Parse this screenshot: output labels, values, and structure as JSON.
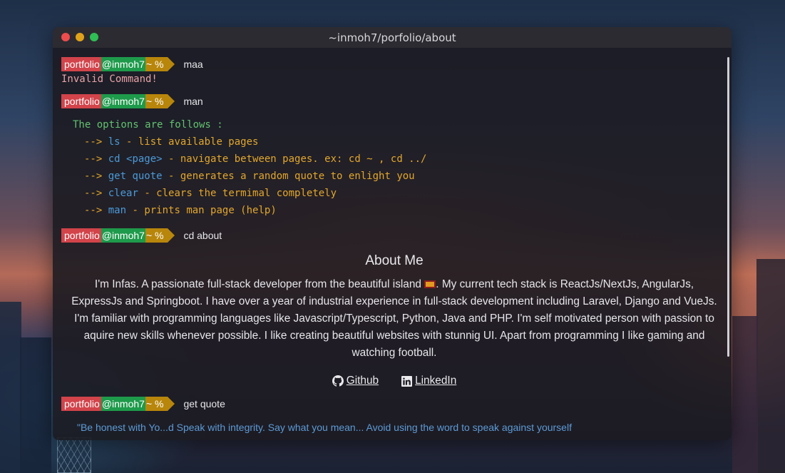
{
  "window": {
    "title": "~inmoh7/porfolio/about"
  },
  "prompt": {
    "user": "portfolio",
    "host": "@inmoh7",
    "dir": "~ %"
  },
  "history": {
    "cmd1": "maa",
    "error1": "Invalid Command!",
    "cmd2": "man",
    "man": {
      "header": "The options are follows :",
      "arrow": "-->",
      "rows": [
        {
          "cmd": "ls",
          "desc": " - list available pages"
        },
        {
          "cmd": "cd <page>",
          "desc": " - navigate between pages. ex: cd ~ , cd ../"
        },
        {
          "cmd": "get quote",
          "desc": " - generates a random quote to enlight you"
        },
        {
          "cmd": "clear",
          "desc": " - clears the termimal completely"
        },
        {
          "cmd": "man",
          "desc": " - prints man page (help)"
        }
      ]
    },
    "cmd3": "cd about",
    "cmd4": "get quote"
  },
  "about": {
    "heading": "About Me",
    "text_before_flag": "I'm Infas. A passionate full-stack developer from the beautiful island ",
    "text_after_flag": ". My current tech stack is ReactJs/NextJs, AngularJs, ExpressJs and Springboot. I have over a year of industrial experience in full-stack development including Laravel, Django and VueJs. I'm familiar with programming languages like Javascript/Typescript, Python, Java and PHP. I'm self motivated person with passion to aquire new skills whenever possible. I like creating beautiful websites with stunnig UI. Apart from programming I like gaming and watching football.",
    "links": {
      "github": "Github",
      "linkedin": "LinkedIn"
    }
  },
  "quote_peek": "\"Be honest with Yo...d Speak with integrity. Say what you mean... Avoid using the word to speak against yourself"
}
